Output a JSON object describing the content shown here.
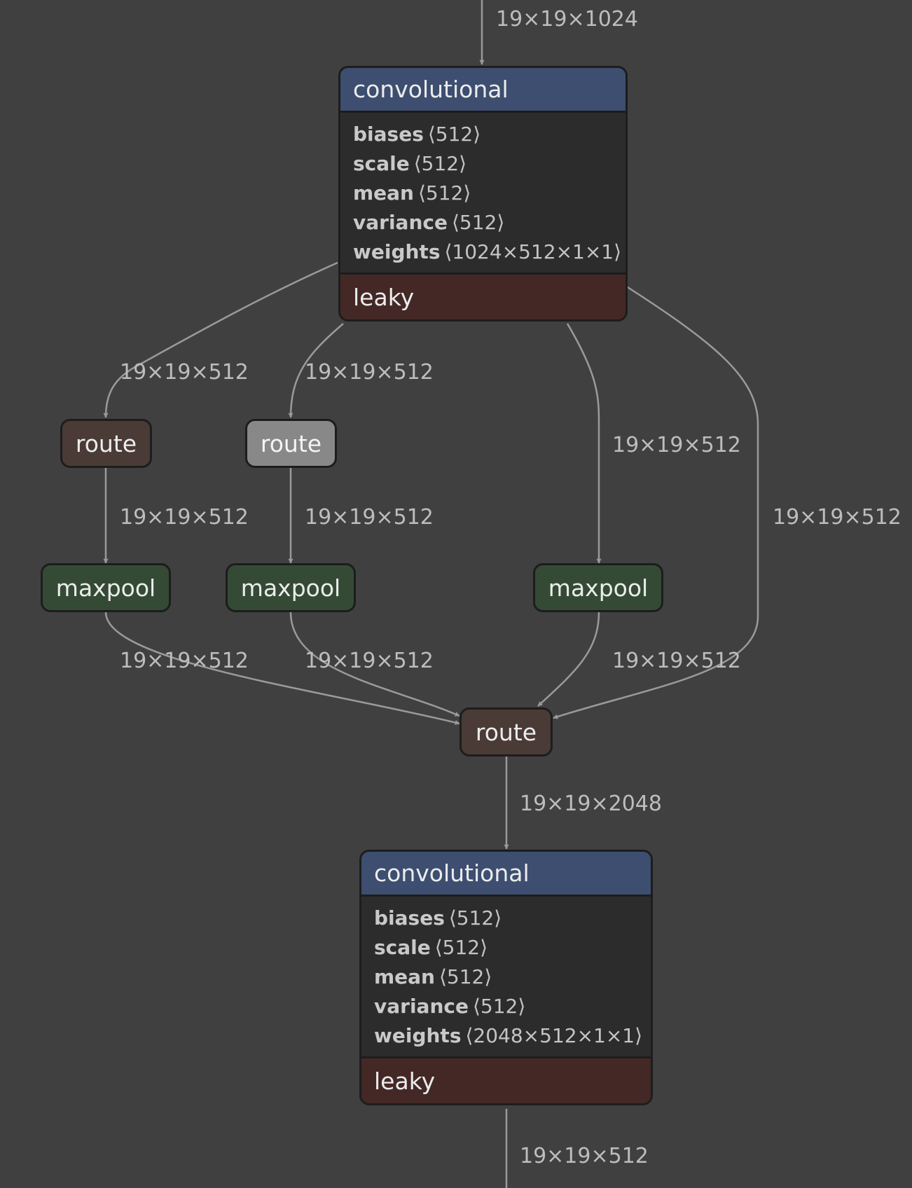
{
  "nodes": {
    "conv1": {
      "title": "convolutional",
      "params": [
        {
          "name": "biases",
          "shape": "⟨512⟩"
        },
        {
          "name": "scale",
          "shape": "⟨512⟩"
        },
        {
          "name": "mean",
          "shape": "⟨512⟩"
        },
        {
          "name": "variance",
          "shape": "⟨512⟩"
        },
        {
          "name": "weights",
          "shape": "⟨1024×512×1×1⟩"
        }
      ],
      "activation": "leaky"
    },
    "route_a": {
      "label": "route"
    },
    "route_b": {
      "label": "route"
    },
    "maxpool_a": {
      "label": "maxpool"
    },
    "maxpool_b": {
      "label": "maxpool"
    },
    "maxpool_c": {
      "label": "maxpool"
    },
    "route_concat": {
      "label": "route"
    },
    "conv2": {
      "title": "convolutional",
      "params": [
        {
          "name": "biases",
          "shape": "⟨512⟩"
        },
        {
          "name": "scale",
          "shape": "⟨512⟩"
        },
        {
          "name": "mean",
          "shape": "⟨512⟩"
        },
        {
          "name": "variance",
          "shape": "⟨512⟩"
        },
        {
          "name": "weights",
          "shape": "⟨2048×512×1×1⟩"
        }
      ],
      "activation": "leaky"
    }
  },
  "edges": {
    "input": "19×19×1024",
    "conv1_route_a": "19×19×512",
    "conv1_route_b": "19×19×512",
    "conv1_maxpool_c": "19×19×512",
    "conv1_route_concat": "19×19×512",
    "route_a_maxpool_a": "19×19×512",
    "route_b_maxpool_b": "19×19×512",
    "maxpool_a_concat": "19×19×512",
    "maxpool_b_concat": "19×19×512",
    "maxpool_c_concat": "19×19×512",
    "concat_conv2": "19×19×2048",
    "output": "19×19×512"
  },
  "colors": {
    "background": "#404040",
    "edge": "#9a9a9a",
    "conv_header": "#3d4e70",
    "activation": "#432826",
    "route": "#4a3b37",
    "route_selected": "#888888",
    "maxpool": "#344a35"
  }
}
